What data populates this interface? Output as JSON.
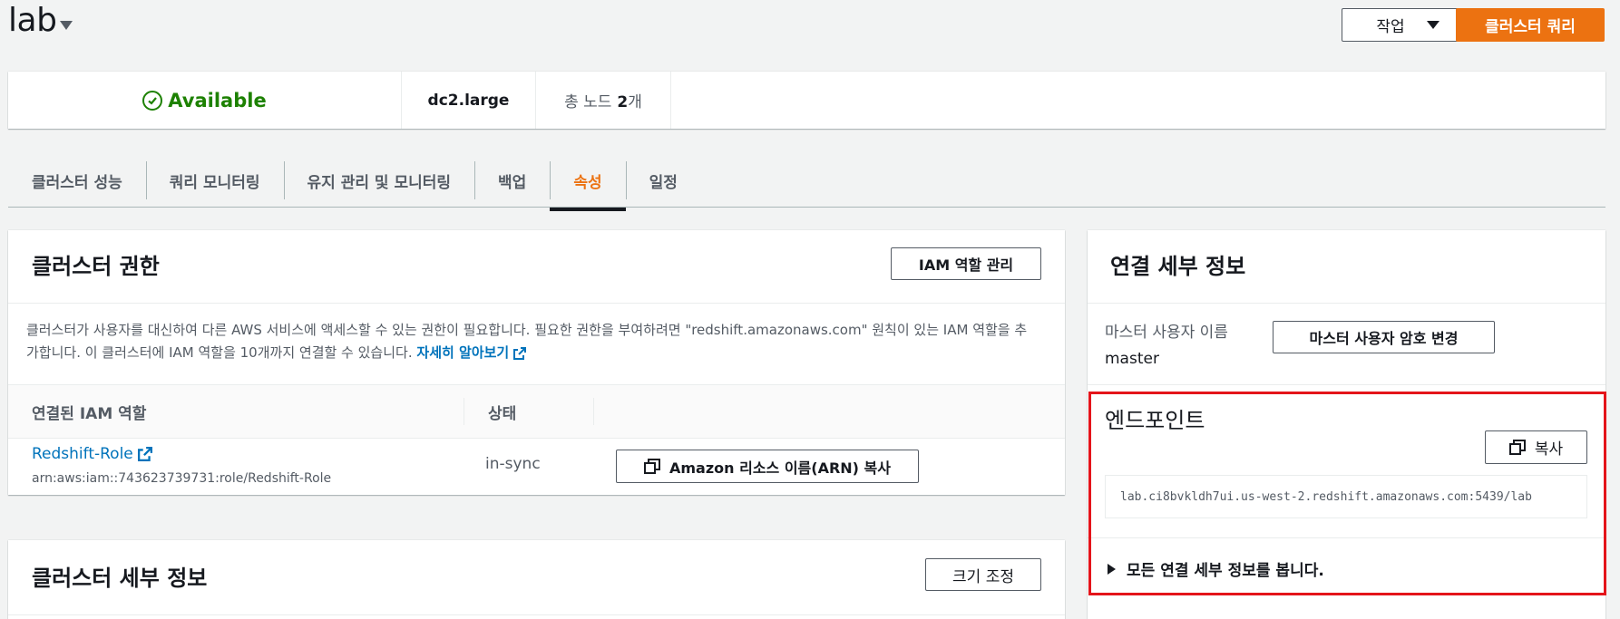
{
  "header": {
    "title": "lab",
    "actions_label": "작업",
    "primary_label": "클러스터 쿼리"
  },
  "summary": {
    "status": "Available",
    "node_type": "dc2.large",
    "nodes_prefix": "총 노드",
    "nodes_count": "2",
    "nodes_suffix": "개"
  },
  "tabs": [
    {
      "label": "클러스터 성능"
    },
    {
      "label": "쿼리 모니터링"
    },
    {
      "label": "유지 관리 및 모니터링"
    },
    {
      "label": "백업"
    },
    {
      "label": "속성",
      "active": true
    },
    {
      "label": "일정"
    }
  ],
  "permissions": {
    "title": "클러스터 권한",
    "manage_button": "IAM 역할 관리",
    "description_line1": "클러스터가 사용자를 대신하여 다른 AWS 서비스에 액세스할 수 있는 권한이 필요합니다. 필요한 권한을 부여하려면 \"redshift.amazonaws.com\" 원칙이 있는 IAM 역할을 추",
    "description_line2": "가합니다. 이 클러스터에 IAM 역할을 10개까지 연결할 수 있습니다.",
    "learn_more": "자세히 알아보기",
    "columns": [
      "연결된 IAM 역할",
      "상태"
    ],
    "rows": [
      {
        "role_name": "Redshift-Role",
        "role_arn": "arn:aws:iam::743623739731:role/Redshift-Role",
        "status": "in-sync",
        "copy_arn_label": "Amazon 리소스 이름(ARN) 복사"
      }
    ]
  },
  "details": {
    "title": "클러스터 세부 정보",
    "resize_button": "크기 조정"
  },
  "connection": {
    "title": "연결 세부 정보",
    "master_user_label": "마스터 사용자 이름",
    "master_user_value": "master",
    "change_password_button": "마스터 사용자 암호 변경",
    "endpoint_label": "엔드포인트",
    "copy_button": "복사",
    "endpoint_value": "lab.ci8bvkldh7ui.us-west-2.redshift.amazonaws.com:5439/lab",
    "expand_label": "모든 연결 세부 정보를 봅니다."
  },
  "colors": {
    "accent": "#ec7211",
    "success": "#1d8102",
    "link": "#0073bb",
    "highlight": "#e4141a"
  }
}
